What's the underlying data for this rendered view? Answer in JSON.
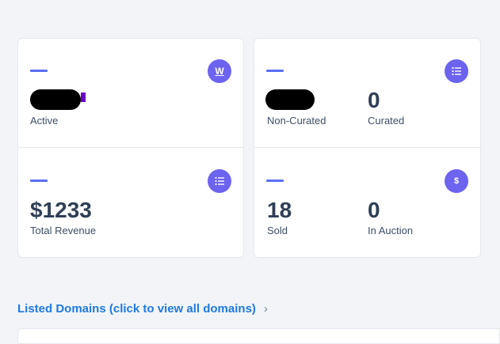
{
  "header": {
    "title": ""
  },
  "cards": {
    "active": {
      "value": "",
      "label": "Active",
      "icon": "w-icon",
      "icon_text": "W"
    },
    "revenue": {
      "value": "$1233",
      "label": "Total Revenue",
      "icon": "list-icon"
    },
    "curation": {
      "non_curated": {
        "value": "",
        "label": "Non-Curated"
      },
      "curated": {
        "value": "0",
        "label": "Curated"
      },
      "icon": "list-icon"
    },
    "sales": {
      "sold": {
        "value": "18",
        "label": "Sold"
      },
      "auction": {
        "value": "0",
        "label": "In Auction"
      },
      "icon": "dollar-icon",
      "icon_text": "$"
    }
  },
  "listed_domains": {
    "link_text": "Listed Domains (click to view all domains)",
    "chevron": "›"
  },
  "colors": {
    "accent": "#6c63ef",
    "dash": "#5a6ff5",
    "link": "#1f7ae0",
    "text": "#2f3f56"
  }
}
